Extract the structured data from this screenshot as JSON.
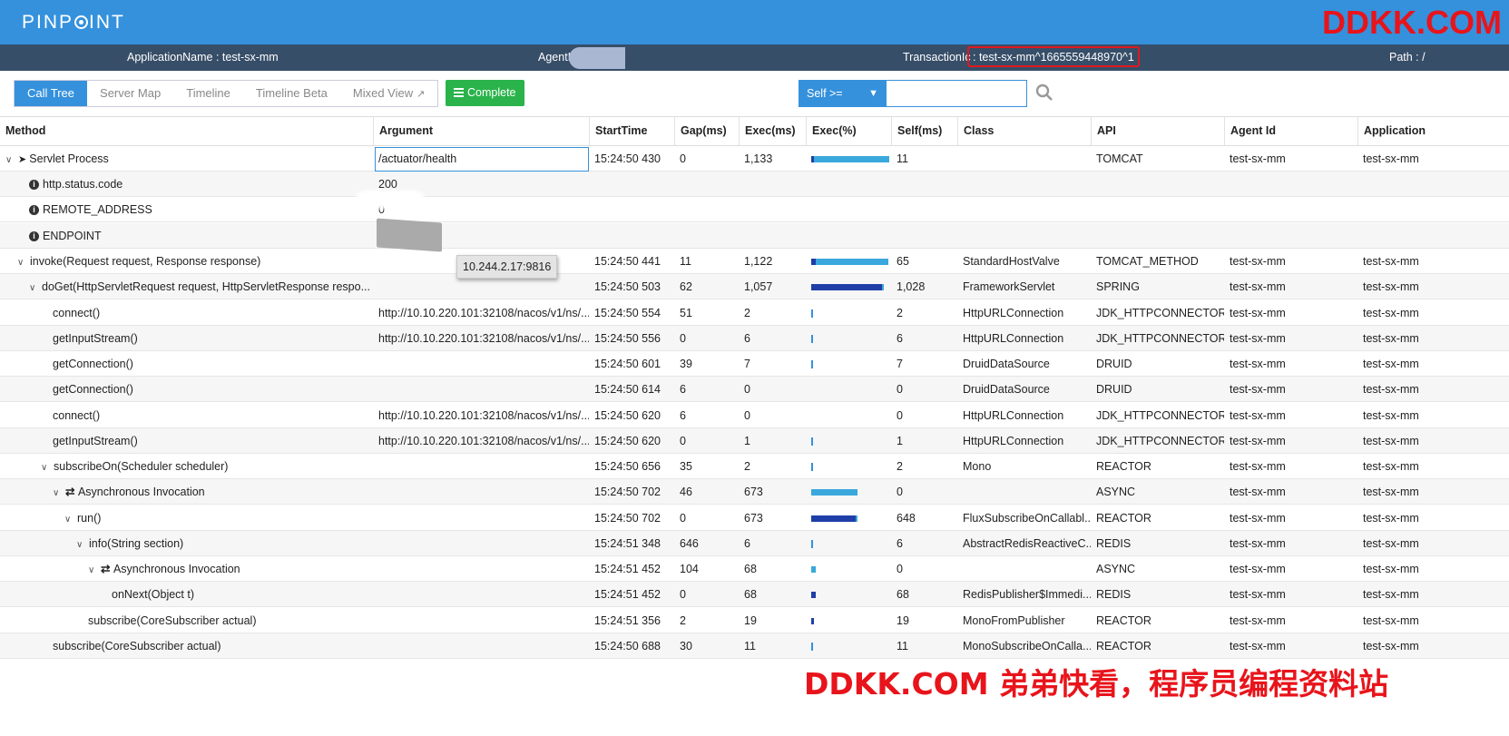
{
  "header": {
    "logo_text": "PINPOINT",
    "logo_prefix": "PINP",
    "logo_suffix": "INT",
    "watermark": "DDKK.COM"
  },
  "info_bar": {
    "application_name": "ApplicationName : test-sx-mm",
    "agent_id": "AgentI",
    "transaction_label": "TransactionIc",
    "transaction_value": ": test-sx-mm^1665559448970^1",
    "path": "Path : /"
  },
  "toolbar": {
    "tabs": [
      {
        "label": "Call Tree",
        "active": true
      },
      {
        "label": "Server Map"
      },
      {
        "label": "Timeline"
      },
      {
        "label": "Timeline Beta"
      },
      {
        "label": "Mixed View"
      }
    ],
    "complete_label": "Complete",
    "filter_select": "Self >=",
    "filter_value": ""
  },
  "columns": [
    "Method",
    "Argument",
    "StartTime",
    "Gap(ms)",
    "Exec(ms)",
    "Exec(%)",
    "Self(ms)",
    "Class",
    "API",
    "Agent Id",
    "Application"
  ],
  "rows": [
    {
      "method": "Servlet Process",
      "depth": 0,
      "caret": true,
      "icon": "plane",
      "arg": "/actuator/health",
      "start": "15:24:50 430",
      "gap": "0",
      "exec": "1,133",
      "pct": 100,
      "self_pct": 1,
      "self": "11",
      "cls": "",
      "api": "TOMCAT",
      "agent": "test-sx-mm",
      "app": "test-sx-mm"
    },
    {
      "method": "http.status.code",
      "depth": 1,
      "icon": "info",
      "arg": "200"
    },
    {
      "method": "REMOTE_ADDRESS",
      "depth": 1,
      "icon": "info",
      "arg": "       0"
    },
    {
      "method": "ENDPOINT",
      "depth": 1,
      "icon": "info",
      "arg": "       816"
    },
    {
      "method": "invoke(Request request, Response response)",
      "depth": 1,
      "caret": true,
      "arg": "",
      "start": "15:24:50 441",
      "gap": "11",
      "exec": "1,122",
      "pct": 99,
      "self_pct": 6,
      "self": "65",
      "cls": "StandardHostValve",
      "api": "TOMCAT_METHOD",
      "agent": "test-sx-mm",
      "app": "test-sx-mm"
    },
    {
      "method": "doGet(HttpServletRequest request, HttpServletResponse respo...",
      "depth": 2,
      "caret": true,
      "arg": "",
      "start": "15:24:50 503",
      "gap": "62",
      "exec": "1,057",
      "pct": 93,
      "self_pct": 91,
      "self": "1,028",
      "cls": "FrameworkServlet",
      "api": "SPRING",
      "agent": "test-sx-mm",
      "app": "test-sx-mm"
    },
    {
      "method": "connect()",
      "depth": 3,
      "arg": "http://10.10.220.101:32108/nacos/v1/ns/...",
      "start": "15:24:50 554",
      "gap": "51",
      "exec": "2",
      "pct": 0,
      "self_pct": 0,
      "tick": true,
      "self": "2",
      "cls": "HttpURLConnection",
      "api": "JDK_HTTPCONNECTOR",
      "agent": "test-sx-mm",
      "app": "test-sx-mm"
    },
    {
      "method": "getInputStream()",
      "depth": 3,
      "arg": "http://10.10.220.101:32108/nacos/v1/ns/...",
      "start": "15:24:50 556",
      "gap": "0",
      "exec": "6",
      "pct": 0,
      "self_pct": 0,
      "tick": true,
      "self": "6",
      "cls": "HttpURLConnection",
      "api": "JDK_HTTPCONNECTOR",
      "agent": "test-sx-mm",
      "app": "test-sx-mm"
    },
    {
      "method": "getConnection()",
      "depth": 3,
      "arg": "",
      "start": "15:24:50 601",
      "gap": "39",
      "exec": "7",
      "pct": 0,
      "self_pct": 0,
      "tick": true,
      "self": "7",
      "cls": "DruidDataSource",
      "api": "DRUID",
      "agent": "test-sx-mm",
      "app": "test-sx-mm"
    },
    {
      "method": "getConnection()",
      "depth": 3,
      "arg": "",
      "start": "15:24:50 614",
      "gap": "6",
      "exec": "0",
      "pct": 0,
      "self_pct": 0,
      "self": "0",
      "cls": "DruidDataSource",
      "api": "DRUID",
      "agent": "test-sx-mm",
      "app": "test-sx-mm"
    },
    {
      "method": "connect()",
      "depth": 3,
      "arg": "http://10.10.220.101:32108/nacos/v1/ns/...",
      "start": "15:24:50 620",
      "gap": "6",
      "exec": "0",
      "pct": 0,
      "self_pct": 0,
      "self": "0",
      "cls": "HttpURLConnection",
      "api": "JDK_HTTPCONNECTOR",
      "agent": "test-sx-mm",
      "app": "test-sx-mm"
    },
    {
      "method": "getInputStream()",
      "depth": 3,
      "arg": "http://10.10.220.101:32108/nacos/v1/ns/...",
      "start": "15:24:50 620",
      "gap": "0",
      "exec": "1",
      "pct": 0,
      "self_pct": 0,
      "tick": true,
      "self": "1",
      "cls": "HttpURLConnection",
      "api": "JDK_HTTPCONNECTOR",
      "agent": "test-sx-mm",
      "app": "test-sx-mm"
    },
    {
      "method": "subscribeOn(Scheduler scheduler)",
      "depth": 3,
      "caret": true,
      "arg": "",
      "start": "15:24:50 656",
      "gap": "35",
      "exec": "2",
      "pct": 0,
      "self_pct": 0,
      "tick": true,
      "self": "2",
      "cls": "Mono",
      "api": "REACTOR",
      "agent": "test-sx-mm",
      "app": "test-sx-mm"
    },
    {
      "method": "Asynchronous Invocation",
      "depth": 4,
      "caret": true,
      "icon": "async",
      "arg": "",
      "start": "15:24:50 702",
      "gap": "46",
      "exec": "673",
      "pct": 59,
      "self_pct": 0,
      "self": "0",
      "cls": "",
      "api": "ASYNC",
      "agent": "test-sx-mm",
      "app": "test-sx-mm"
    },
    {
      "method": "run()",
      "depth": 5,
      "caret": true,
      "arg": "",
      "start": "15:24:50 702",
      "gap": "0",
      "exec": "673",
      "pct": 59,
      "self_pct": 57,
      "self": "648",
      "cls": "FluxSubscribeOnCallabl...",
      "api": "REACTOR",
      "agent": "test-sx-mm",
      "app": "test-sx-mm"
    },
    {
      "method": "info(String section)",
      "depth": 6,
      "caret": true,
      "arg": "",
      "start": "15:24:51 348",
      "gap": "646",
      "exec": "6",
      "pct": 0,
      "self_pct": 0,
      "tick": true,
      "self": "6",
      "cls": "AbstractRedisReactiveC...",
      "api": "REDIS",
      "agent": "test-sx-mm",
      "app": "test-sx-mm"
    },
    {
      "method": "Asynchronous Invocation",
      "depth": 7,
      "caret": true,
      "icon": "async",
      "arg": "",
      "start": "15:24:51 452",
      "gap": "104",
      "exec": "68",
      "pct": 6,
      "self_pct": 0,
      "self": "0",
      "cls": "",
      "api": "ASYNC",
      "agent": "test-sx-mm",
      "app": "test-sx-mm"
    },
    {
      "method": "onNext(Object t)",
      "depth": 8,
      "arg": "",
      "start": "15:24:51 452",
      "gap": "0",
      "exec": "68",
      "pct": 6,
      "self_pct": 6,
      "self": "68",
      "cls": "RedisPublisher$Immedi...",
      "api": "REDIS",
      "agent": "test-sx-mm",
      "app": "test-sx-mm"
    },
    {
      "method": "subscribe(CoreSubscriber actual)",
      "depth": 6,
      "arg": "",
      "start": "15:24:51 356",
      "gap": "2",
      "exec": "19",
      "pct": 2,
      "self_pct": 2,
      "tick": true,
      "self": "19",
      "cls": "MonoFromPublisher",
      "api": "REACTOR",
      "agent": "test-sx-mm",
      "app": "test-sx-mm"
    },
    {
      "method": "subscribe(CoreSubscriber actual)",
      "depth": 3,
      "arg": "",
      "start": "15:24:50 688",
      "gap": "30",
      "exec": "11",
      "pct": 1,
      "self_pct": 1,
      "tick": true,
      "self": "11",
      "cls": "MonoSubscribeOnCalla...",
      "api": "REACTOR",
      "agent": "test-sx-mm",
      "app": "test-sx-mm"
    }
  ],
  "tooltip": "10.244.2.17:9816",
  "watermark_bottom": "DDKK.COM 弟弟快看，程序员编程资料站",
  "colors": {
    "brand": "#3591dc",
    "info_bar": "#374e68",
    "complete": "#2ab34b",
    "bar_exec": "#3aa8dc",
    "bar_self": "#1f3ea8",
    "watermark": "#e8141b"
  }
}
